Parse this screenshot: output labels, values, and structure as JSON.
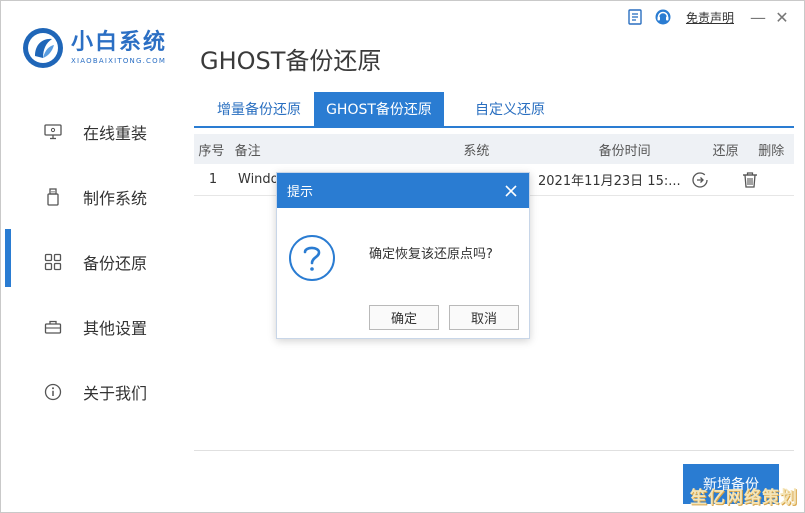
{
  "window": {
    "disclaimer_link": "免责声明",
    "minimize": "—",
    "close": "✕"
  },
  "logo": {
    "name_cn": "小白系统",
    "name_en": "XIAOBAIXITONG.COM"
  },
  "page_title": "GHOST备份还原",
  "sidebar": {
    "items": [
      {
        "label": "在线重装",
        "icon": "monitor-icon"
      },
      {
        "label": "制作系统",
        "icon": "usb-drive-icon"
      },
      {
        "label": "备份还原",
        "icon": "grid-icon",
        "active": true
      },
      {
        "label": "其他设置",
        "icon": "toolbox-icon"
      },
      {
        "label": "关于我们",
        "icon": "info-icon"
      }
    ]
  },
  "tabs": [
    {
      "label": "增量备份还原"
    },
    {
      "label": "GHOST备份还原",
      "active": true
    },
    {
      "label": "自定义还原"
    }
  ],
  "table": {
    "headers": {
      "seq": "序号",
      "note": "备注",
      "system": "系统",
      "time": "备份时间",
      "restore": "还原",
      "delete": "删除"
    },
    "rows": [
      {
        "seq": "1",
        "note": "Windo",
        "system": "",
        "time": "2021年11月23日 15:..."
      }
    ]
  },
  "new_backup_button": "新增备份",
  "dialog": {
    "title": "提示",
    "message": "确定恢复该还原点吗?",
    "ok": "确定",
    "cancel": "取消"
  },
  "watermark": "笙亿网络策划",
  "colors": {
    "accent": "#2a7cd2",
    "brand": "#2b6fc4"
  }
}
